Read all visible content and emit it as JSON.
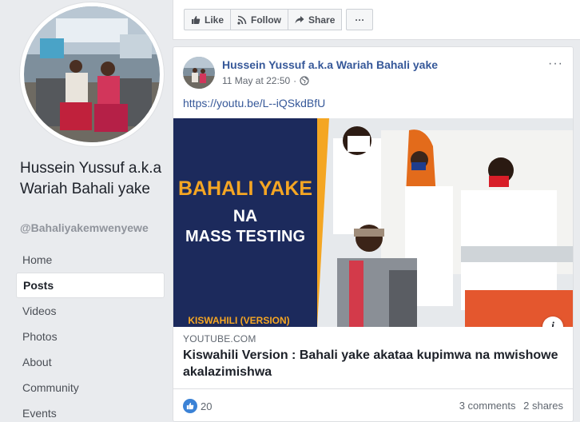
{
  "page": {
    "name": "Hussein Yussuf a.k.a Wariah Bahali yake",
    "handle": "@Bahaliyakemwenyewe",
    "nav": [
      "Home",
      "Posts",
      "Videos",
      "Photos",
      "About",
      "Community",
      "Events"
    ],
    "active_nav": "Posts"
  },
  "actions": {
    "like": "Like",
    "follow": "Follow",
    "share": "Share",
    "more": "···"
  },
  "post": {
    "author": "Hussein Yussuf a.k.a Wariah Bahali yake",
    "timestamp": "11 May at 22:50",
    "separator": "·",
    "audience_icon": "globe-icon",
    "text": "https://youtu.be/L--iQSkdBfU",
    "more": "···",
    "thumbnail": {
      "line1": "BAHALI YAKE",
      "line2": "NA",
      "line3": "MASS TESTING",
      "footer": "KISWAHILI (VERSION)"
    },
    "info_icon": "i",
    "link": {
      "domain": "YOUTUBE.COM",
      "title": "Kiswahili Version : Bahali yake akataa kupimwa na mwishowe akalazimishwa"
    },
    "reactions": "20",
    "comments": "3 comments",
    "shares": "2 shares"
  },
  "colors": {
    "link_blue": "#365899",
    "thumb_title": "#f5a623",
    "like_blue": "#3b82d6"
  }
}
